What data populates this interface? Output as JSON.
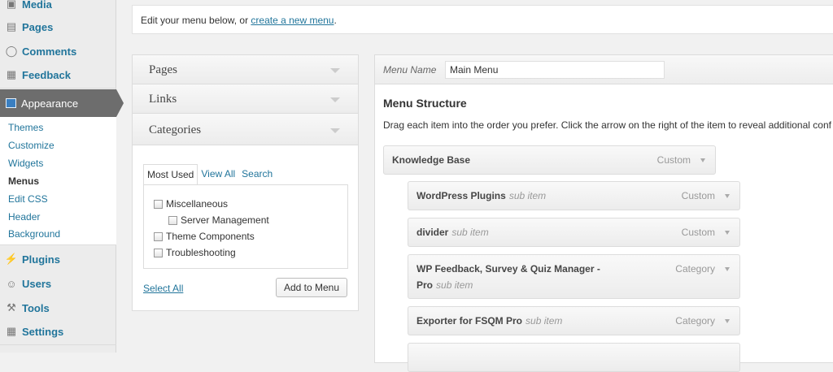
{
  "sidebar": {
    "items_top": [
      {
        "label": "Media",
        "icon": "media-icon"
      },
      {
        "label": "Pages",
        "icon": "pages-icon"
      },
      {
        "label": "Comments",
        "icon": "comments-icon"
      },
      {
        "label": "Feedback",
        "icon": "feedback-icon"
      }
    ],
    "appearance": {
      "label": "Appearance",
      "icon": "appearance-icon"
    },
    "submenu": [
      {
        "label": "Themes"
      },
      {
        "label": "Customize"
      },
      {
        "label": "Widgets"
      },
      {
        "label": "Menus",
        "current": true
      },
      {
        "label": "Edit CSS"
      },
      {
        "label": "Header"
      },
      {
        "label": "Background"
      }
    ],
    "items_bottom": [
      {
        "label": "Plugins",
        "icon": "plugins-icon"
      },
      {
        "label": "Users",
        "icon": "users-icon"
      },
      {
        "label": "Tools",
        "icon": "tools-icon"
      },
      {
        "label": "Settings",
        "icon": "settings-icon"
      }
    ]
  },
  "notice": {
    "text": "Edit your menu below, or ",
    "link": "create a new menu",
    "suffix": "."
  },
  "accordion": {
    "sections": [
      {
        "title": "Pages"
      },
      {
        "title": "Links"
      },
      {
        "title": "Categories"
      }
    ],
    "tabs": [
      "Most Used",
      "View All",
      "Search"
    ],
    "categories": [
      {
        "label": "Miscellaneous",
        "checked": false
      },
      {
        "label": "Server Management",
        "checked": false
      },
      {
        "label": "Theme Components",
        "checked": false
      },
      {
        "label": "Troubleshooting",
        "checked": false
      }
    ],
    "select_all": "Select All",
    "add_button": "Add to Menu"
  },
  "editor": {
    "menu_name_label": "Menu Name",
    "menu_name_value": "Main Menu",
    "structure_title": "Menu Structure",
    "structure_desc": "Drag each item into the order you prefer. Click the arrow on the right of the item to reveal additional conf",
    "items": [
      {
        "title": "Knowledge Base",
        "sub": "",
        "type": "Custom"
      },
      {
        "title": "WordPress Plugins",
        "sub": "sub item",
        "type": "Custom"
      },
      {
        "title": "divider",
        "sub": "sub item",
        "type": "Custom"
      },
      {
        "title": "WP Feedback, Survey & Quiz Manager -",
        "title2": "Pro",
        "sub": "sub item",
        "type": "Category"
      },
      {
        "title": "Exporter for FSQM Pro",
        "sub": "sub item",
        "type": "Category"
      }
    ]
  },
  "colors": {
    "link": "#21759b",
    "appearance_bg": "#6d6d6d"
  }
}
